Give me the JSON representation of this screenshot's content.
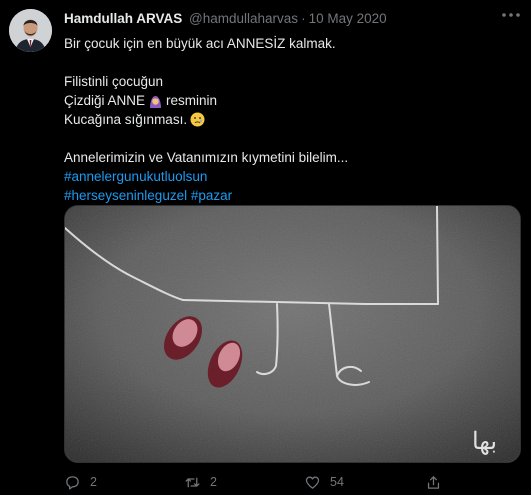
{
  "author": {
    "name": "Hamdullah ARVAS",
    "handle": "@hamdullaharvas",
    "separator": "·",
    "date": "10 May 2020"
  },
  "more_icon": "more-icon",
  "tweet": {
    "line1": "Bir çocuk için en büyük acı ANNESİZ kalmak.",
    "line2": "Filistinli çocuğun",
    "line3a": "Çizdiği ANNE",
    "line3b": "resminin",
    "line4": "Kucağına sığınması.",
    "line5": "Annelerimizin ve Vatanımızın  kıymetini bilelim...",
    "hashtag1": "#annelergunukutluolsun",
    "hashtag2": "#herseyseninleguzel",
    "hashtag3": "#pazar"
  },
  "media": {
    "watermark": "بها"
  },
  "actions": {
    "reply_count": "2",
    "retweet_count": "2",
    "like_count": "54"
  },
  "colors": {
    "background": "#000000",
    "text": "#e7e9ea",
    "muted": "#71767b",
    "link": "#1d9bf0"
  }
}
